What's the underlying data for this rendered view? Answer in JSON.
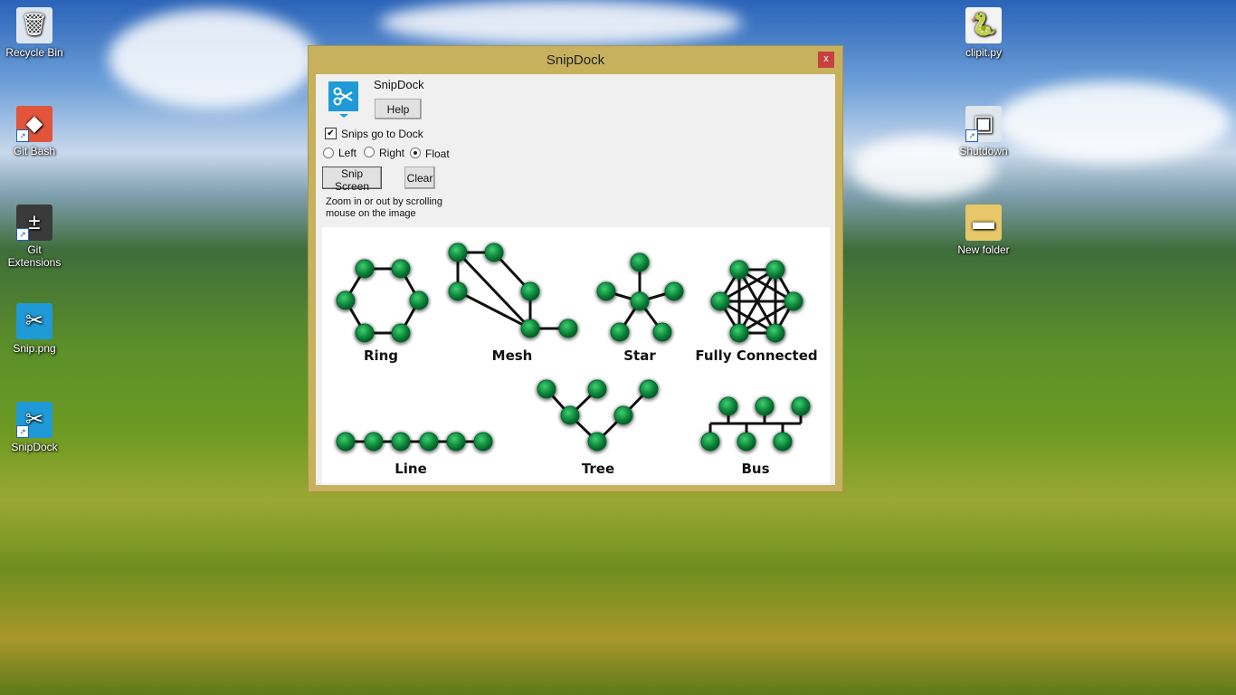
{
  "desktop": {
    "left_icons": [
      {
        "label": "Recycle Bin",
        "icon": "recycle-bin-icon"
      },
      {
        "label": "Git Bash",
        "icon": "git-bash-icon"
      },
      {
        "label": "Git Extensions",
        "icon": "git-extensions-icon"
      },
      {
        "label": "Snip.png",
        "icon": "snip-image-icon"
      },
      {
        "label": "SnipDock",
        "icon": "snipdock-icon"
      }
    ],
    "right_icons": [
      {
        "label": "clipit.py",
        "icon": "python-file-icon"
      },
      {
        "label": "Shutdown",
        "icon": "shutdown-shortcut-icon"
      },
      {
        "label": "New folder",
        "icon": "folder-icon"
      }
    ]
  },
  "window": {
    "title": "SnipDock",
    "close_label": "x",
    "app_name": "SnipDock",
    "help_label": "Help",
    "snips_to_dock_label": "Snips go to Dock",
    "snips_to_dock_checked": true,
    "dock_options": [
      "Left",
      "Right",
      "Float"
    ],
    "dock_selected": "Float",
    "snip_screen_label": "Snip Screen",
    "clear_label": "Clear",
    "hint_line1": "Zoom in or out by scrolling",
    "hint_line2": "mouse on the image",
    "accent": "#1f9ad6",
    "frame_color": "#c7b15c"
  },
  "snip_image": {
    "node_color": "#0f8a3c",
    "topologies": [
      "Ring",
      "Mesh",
      "Star",
      "Fully Connected",
      "Line",
      "Tree",
      "Bus"
    ]
  }
}
